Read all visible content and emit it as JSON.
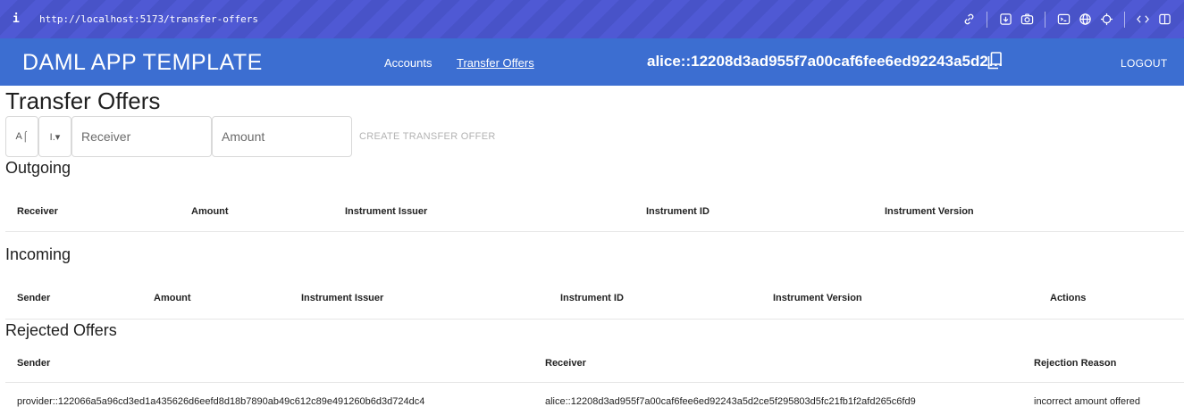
{
  "browser": {
    "info_icon": "i",
    "url": "http://localhost:5173/transfer-offers",
    "icons": [
      "link-icon",
      "download-icon",
      "camera-icon",
      "terminal-icon",
      "globe-icon",
      "crosshair-icon",
      "code-icon",
      "sidebar-icon"
    ]
  },
  "header": {
    "app_title": "DAML APP TEMPLATE",
    "nav": {
      "accounts": "Accounts",
      "transfer_offers": "Transfer Offers"
    },
    "party": "alice::12208d3ad955f7a00caf6fee6ed92243a5d2…",
    "logout": "LOGOUT",
    "color": "#3c6ed1"
  },
  "page": {
    "title": "Transfer Offers"
  },
  "form": {
    "select1": "A⌠",
    "select2": "I.▾",
    "receiver_placeholder": "Receiver",
    "amount_placeholder": "Amount",
    "create_label": "CREATE TRANSFER OFFER"
  },
  "outgoing": {
    "title": "Outgoing",
    "columns": [
      "Receiver",
      "Amount",
      "Instrument Issuer",
      "Instrument ID",
      "Instrument Version"
    ]
  },
  "incoming": {
    "title": "Incoming",
    "columns": [
      "Sender",
      "Amount",
      "Instrument Issuer",
      "Instrument ID",
      "Instrument Version",
      "Actions"
    ]
  },
  "rejected": {
    "title": "Rejected Offers",
    "columns": [
      "Sender",
      "Receiver",
      "Rejection Reason"
    ],
    "rows": [
      {
        "sender": "provider::122066a5a96cd3ed1a435626d6eefd8d18b7890ab49c612c89e491260b6d3d724dc4",
        "receiver": "alice::12208d3ad955f7a00caf6fee6ed92243a5d2ce5f295803d5fc21fb1f2afd265c6fd9",
        "reason": "incorrect amount offered"
      }
    ]
  }
}
